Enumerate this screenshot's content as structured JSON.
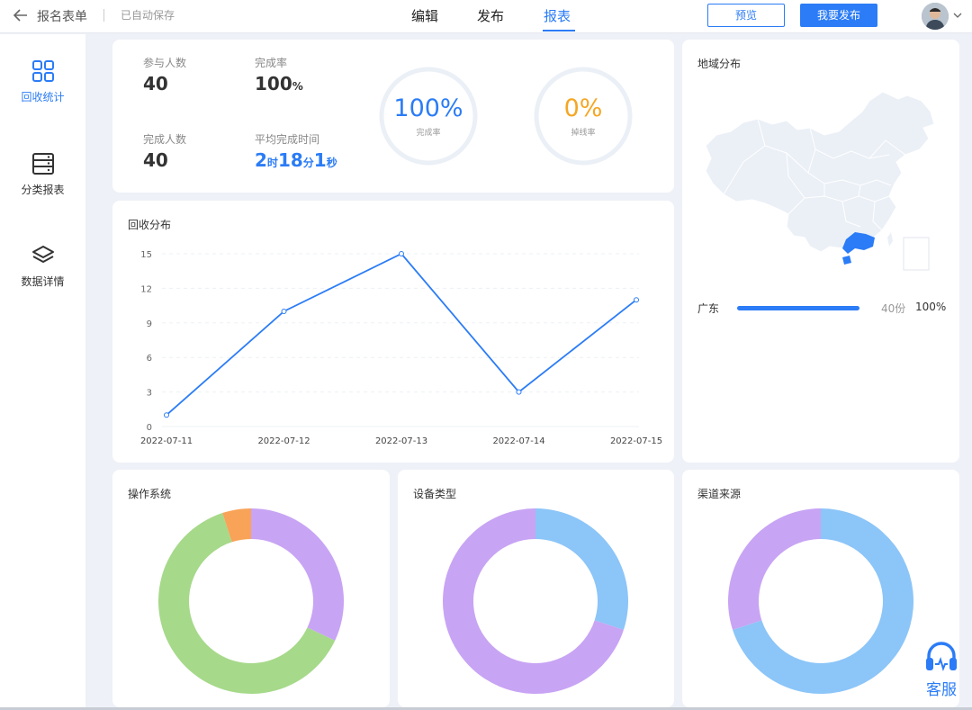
{
  "header": {
    "form_title": "报名表单",
    "autosave": "已自动保存",
    "tabs": [
      {
        "label": "编辑",
        "active": false
      },
      {
        "label": "发布",
        "active": false
      },
      {
        "label": "报表",
        "active": true
      }
    ],
    "preview_label": "预览",
    "publish_label": "我要发布"
  },
  "sidebar": {
    "items": [
      {
        "label": "回收统计",
        "icon": "grid-icon",
        "active": true
      },
      {
        "label": "分类报表",
        "icon": "server-stack-icon",
        "active": false
      },
      {
        "label": "数据详情",
        "icon": "layers-icon",
        "active": false
      }
    ]
  },
  "summary": {
    "participants_label": "参与人数",
    "participants_value": "40",
    "completion_rate_label": "完成率",
    "completion_rate_value": "100",
    "completion_rate_unit": "%",
    "completed_label": "完成人数",
    "completed_value": "40",
    "avg_time_label": "平均完成时间",
    "avg_time": {
      "h": "2",
      "h_unit": "时",
      "m": "18",
      "m_unit": "分",
      "s": "1",
      "s_unit": "秒"
    },
    "ring_completion": {
      "value": "100%",
      "label": "完成率",
      "fraction": 1.0,
      "color": "#2b7cf6"
    },
    "ring_dropout": {
      "value": "0%",
      "label": "掉线率",
      "fraction": 0.0,
      "color": "#f5a623"
    }
  },
  "region": {
    "title": "地域分布",
    "items": [
      {
        "name": "广东",
        "count": "40份",
        "pct": "100%",
        "fraction": 1.0
      }
    ]
  },
  "recovery": {
    "title": "回收分布"
  },
  "os": {
    "title": "操作系统"
  },
  "device": {
    "title": "设备类型"
  },
  "channel": {
    "title": "渠道来源"
  },
  "support": {
    "label": "客服"
  },
  "colors": {
    "accent": "#2b7cf6",
    "green": "#a6d98a",
    "purple": "#c8a4f4",
    "orange": "#f8a358",
    "sky": "#8cc5f8",
    "ring_track": "#ebf0f7"
  },
  "chart_data": [
    {
      "type": "line",
      "title": "回收分布",
      "x": [
        "2022-07-11",
        "2022-07-12",
        "2022-07-13",
        "2022-07-14",
        "2022-07-15"
      ],
      "series": [
        {
          "values": [
            1,
            10,
            15,
            3,
            11
          ]
        }
      ],
      "ylim": [
        0,
        15
      ],
      "yticks": [
        0,
        3,
        6,
        9,
        12,
        15
      ],
      "grid": true
    },
    {
      "type": "pie",
      "title": "操作系统",
      "slices": [
        {
          "value": 32,
          "color": "#c8a4f4"
        },
        {
          "value": 63,
          "color": "#a6d98a"
        },
        {
          "value": 5,
          "color": "#f8a358"
        }
      ]
    },
    {
      "type": "pie",
      "title": "设备类型",
      "slices": [
        {
          "value": 30,
          "color": "#8cc5f8"
        },
        {
          "value": 70,
          "color": "#c8a4f4"
        }
      ]
    },
    {
      "type": "pie",
      "title": "渠道来源",
      "slices": [
        {
          "value": 70,
          "color": "#8cc5f8"
        },
        {
          "value": 30,
          "color": "#c8a4f4"
        }
      ]
    }
  ]
}
